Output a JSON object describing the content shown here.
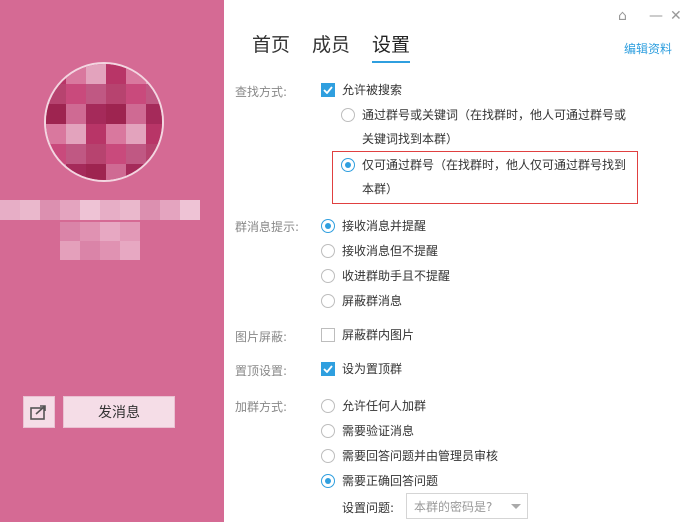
{
  "tabs": [
    "首页",
    "成员",
    "设置"
  ],
  "edit_link": "编辑资料",
  "left_panel": {
    "message_button": "发消息"
  },
  "window_controls": {
    "pin": "⌂",
    "minimize": "—",
    "close": "✕"
  },
  "search": {
    "label": "查找方式:",
    "allow_search": "允许被搜索",
    "option1_line1": "通过群号或关键词（在找群时，他人可通过群号或",
    "option1_line2": "关键词找到本群）",
    "option2_line1": "仅可通过群号（在找群时，他人仅可通过群号找到",
    "option2_line2": "本群）"
  },
  "notify": {
    "label": "群消息提示:",
    "options": [
      "接收消息并提醒",
      "接收消息但不提醒",
      "收进群助手且不提醒",
      "屏蔽群消息"
    ]
  },
  "image_block": {
    "label": "图片屏蔽:",
    "option": "屏蔽群内图片"
  },
  "pin_top": {
    "label": "置顶设置:",
    "option": "设为置顶群"
  },
  "join": {
    "label": "加群方式:",
    "options": [
      "允许任何人加群",
      "需要验证消息",
      "需要回答问题并由管理员审核",
      "需要正确回答问题"
    ],
    "question_label": "设置问题:",
    "question_placeholder": "本群的密码是?"
  },
  "colors": {
    "panel": "#d56a94",
    "accent": "#2f9fdf",
    "highlight": "#e04040"
  }
}
